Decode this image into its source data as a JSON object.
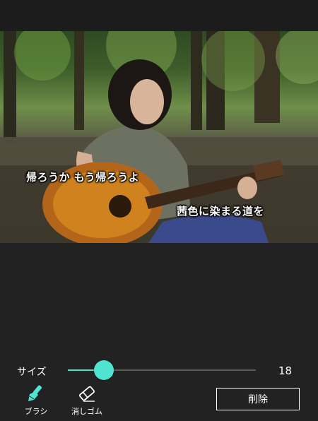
{
  "photo": {
    "captions": [
      "帰ろうか もう帰ろうよ",
      "茜色に染まる道を"
    ]
  },
  "controls": {
    "size_label": "サイズ",
    "size_value": "18",
    "slider_level_fraction": 0.19,
    "accent_color": "#4fe3d2"
  },
  "tools": [
    {
      "label": "ブラシ",
      "icon": "brush-icon",
      "active": true
    },
    {
      "label": "消しゴム",
      "icon": "eraser-icon",
      "active": false
    }
  ],
  "delete_button": {
    "label": "削除"
  }
}
